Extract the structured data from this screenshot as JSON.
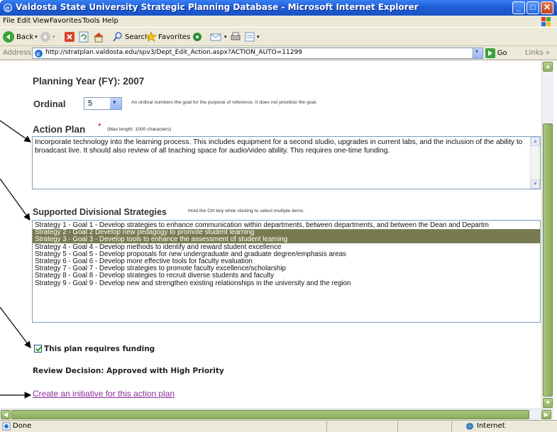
{
  "window": {
    "title": "Valdosta State University Strategic Planning Database - Microsoft Internet Explorer"
  },
  "menu": [
    "File",
    "Edit",
    "View",
    "Favorites",
    "Tools",
    "Help"
  ],
  "toolbar": {
    "back_label": "Back",
    "search_label": "Search",
    "favorites_label": "Favorites"
  },
  "address": {
    "label": "Address",
    "url": "http://stratplan.valdosta.edu/spv3/Dept_Edit_Action.aspx?ACTION_AUTO=11299",
    "go_label": "Go",
    "links_label": "Links"
  },
  "form": {
    "planning_year": "Planning Year (FY): 2007",
    "ordinal_label": "Ordinal",
    "ordinal_value": "5",
    "ordinal_help": "An ordinal numbers the goal for the purpose of reference. It does not prioritize the goal.",
    "action_plan_label": "Action Plan",
    "required_mark": "*",
    "max_length": "(Max length: 1000 characters)",
    "action_plan_text": "Incorporate technology into the learning process. This includes equipment for a second studio, upgrades in current labs, and the inclusion of the ability to broadcast live. It should also review of all teaching space for audio/video ability. This requires one-time funding.",
    "strategies_label": "Supported Divisional Strategies",
    "strategies_help": "Hold the Ctrl key while clicking to select multiple items.",
    "strategies": [
      {
        "text": "Strategy 1 - Goal 1 - Develop strategies to enhance communication within departments, between departments, and between the Dean and Departm",
        "selected": false
      },
      {
        "text": "Strategy 2 - Goal 2 Develop new pedagogy to promote student learning",
        "selected": true
      },
      {
        "text": "Strategy 3 - Goal 3 - Develop tools to enhance the assessment of student learning",
        "selected": true
      },
      {
        "text": "Strategy 4 - Goal 4 - Develop methods to identify and reward student excellence",
        "selected": false
      },
      {
        "text": "Strategy 5 - Goal 5 - Develop proposals for new undergraduate and graduate degree/emphasis areas",
        "selected": false
      },
      {
        "text": "Strategy 6 - Goal 6 - Develop more effective tools for faculty evaluation",
        "selected": false
      },
      {
        "text": "Strategy 7 - Goal 7 - Develop strategies to promote faculty excellence/scholarship",
        "selected": false
      },
      {
        "text": "Strategy 8 - Goal 8 - Develop strategies to recruit diverse students and faculty",
        "selected": false
      },
      {
        "text": "Strategy 9 - Goal 9 - Develop new and strengthen existing relationships in the university and the region",
        "selected": false
      }
    ],
    "funding_checked": true,
    "funding_label": "This plan requires funding",
    "review_decision": "Review Decision: Approved with High Priority",
    "create_link": "Create an initiative for this action plan"
  },
  "status": {
    "left": "Done",
    "zone": "Internet"
  },
  "colors": {
    "selected_item": "#7a7a52",
    "link": "#8a2a9a",
    "required": "#e00000",
    "titlebar": "#1f5fd6"
  }
}
